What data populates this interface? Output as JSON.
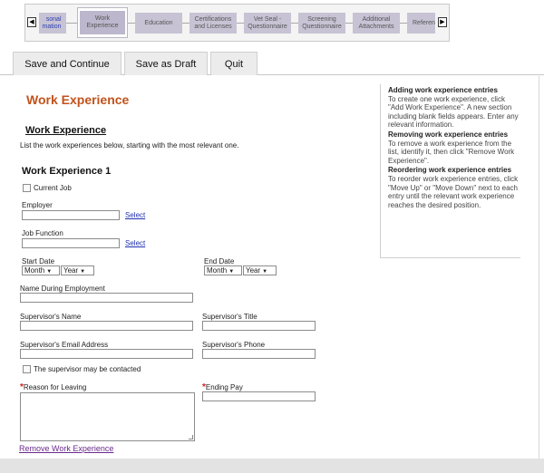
{
  "wizard": {
    "prev_arrow": "◀",
    "next_arrow": "▶",
    "steps": [
      {
        "label": "sonal\nmation"
      },
      {
        "label": "Work\nExperience"
      },
      {
        "label": "Education"
      },
      {
        "label": "Certifications\nand Licenses"
      },
      {
        "label": "Vet Seal -\nQuestionnaire"
      },
      {
        "label": "Screening\nQuestionnaire"
      },
      {
        "label": "Additional\nAttachments"
      },
      {
        "label": "Referen"
      }
    ]
  },
  "tabs": {
    "save_continue": "Save and Continue",
    "save_draft": "Save as Draft",
    "quit": "Quit"
  },
  "form": {
    "page_title": "Work Experience",
    "section_title": "Work Experience",
    "intro": "List the work experiences below, starting with the most relevant one.",
    "entry_title": "Work Experience 1",
    "current_job": "Current Job",
    "employer": "Employer",
    "job_function": "Job Function",
    "select_link": "Select",
    "start_date": "Start Date",
    "end_date": "End Date",
    "month": "Month",
    "year": "Year",
    "name_during": "Name During Employment",
    "sup_name": "Supervisor's Name",
    "sup_title": "Supervisor's Title",
    "sup_email": "Supervisor's Email Address",
    "sup_phone": "Supervisor's Phone",
    "may_contact": "The supervisor may be contacted",
    "required_mark": "*",
    "reason": "Reason for Leaving",
    "ending_pay": "Ending Pay",
    "remove": "Remove Work Experience"
  },
  "help": {
    "add_title": "Adding work experience entries",
    "add_body": "To create one work experience, click \"Add Work Experience\". A new section including blank fields appears. Enter any relevant information.",
    "remove_title": "Removing work experience entries",
    "remove_body": "To remove a work experience from the list, identify it, then click \"Remove Work Experience\".",
    "reorder_title": "Reordering work experience entries",
    "reorder_body": "To reorder work experience entries, click \"Move Up\" or \"Move Down\" next to each entry until the relevant work experience reaches the desired position."
  }
}
